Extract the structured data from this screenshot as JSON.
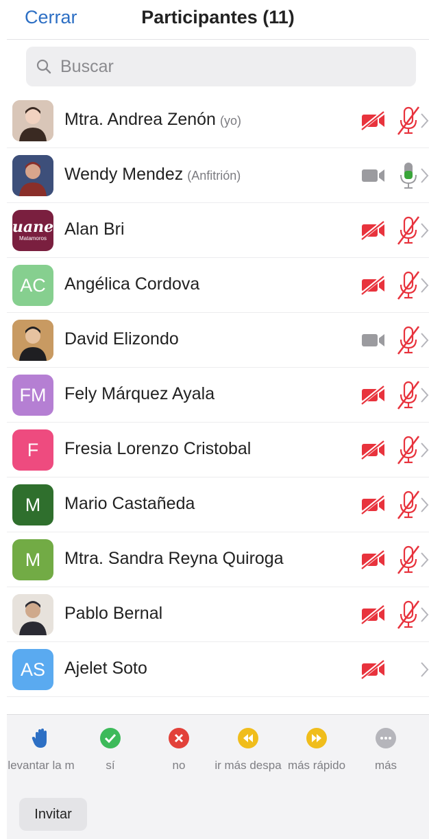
{
  "header": {
    "close_label": "Cerrar",
    "title": "Participantes (11)"
  },
  "search": {
    "placeholder": "Buscar"
  },
  "colors": {
    "accent": "#2d6fc4",
    "muted_red": "#e8333d",
    "mic_green": "#3aa53a",
    "camera_gray": "#9b9b9f"
  },
  "participants": [
    {
      "name": "Mtra. Andrea Zenón",
      "role": "(yo)",
      "avatar_type": "photo",
      "avatar_icon": "avatar-photo",
      "video": "off",
      "mic": "muted"
    },
    {
      "name": "Wendy Mendez",
      "role": "(Anfitrión)",
      "avatar_type": "photo",
      "avatar_icon": "avatar-photo",
      "video": "on",
      "mic": "on"
    },
    {
      "name": "Alan Bri",
      "role": "",
      "avatar_type": "logo",
      "avatar_logo_text": "uane",
      "avatar_logo_sub": "Matamoros",
      "avatar_color": "#7a1f3f",
      "video": "off",
      "mic": "muted"
    },
    {
      "name": "Angélica Cordova",
      "role": "",
      "avatar_type": "initials",
      "initials": "AC",
      "avatar_color": "#86cf8f",
      "video": "off",
      "mic": "muted"
    },
    {
      "name": "David Elizondo",
      "role": "",
      "avatar_type": "photo",
      "avatar_icon": "avatar-photo",
      "video": "on",
      "mic": "muted"
    },
    {
      "name": "Fely Márquez Ayala",
      "role": "",
      "avatar_type": "initials",
      "initials": "FM",
      "avatar_color": "#b57fd3",
      "video": "off",
      "mic": "muted"
    },
    {
      "name": "Fresia Lorenzo Cristobal",
      "role": "",
      "avatar_type": "initials",
      "initials": "F",
      "avatar_color": "#ee4b7f",
      "video": "off",
      "mic": "muted"
    },
    {
      "name": "Mario Castañeda",
      "role": "",
      "avatar_type": "initials",
      "initials": "M",
      "avatar_color": "#2f6f2d",
      "video": "off",
      "mic": "muted"
    },
    {
      "name": "Mtra. Sandra Reyna Quiroga",
      "role": "",
      "avatar_type": "initials",
      "initials": "M",
      "avatar_color": "#72ab45",
      "video": "off",
      "mic": "muted"
    },
    {
      "name": "Pablo Bernal",
      "role": "",
      "avatar_type": "photo",
      "avatar_icon": "avatar-photo",
      "video": "off",
      "mic": "muted"
    },
    {
      "name": "Ajelet Soto",
      "role": "",
      "avatar_type": "initials",
      "initials": "AS",
      "avatar_color": "#5aaaf0",
      "video": "off",
      "mic": "none"
    }
  ],
  "reactions": [
    {
      "label": "levantar la m",
      "icon": "raise-hand-icon",
      "color": "#2d6fc4"
    },
    {
      "label": "sí",
      "icon": "check-icon",
      "color": "#3dba5a"
    },
    {
      "label": "no",
      "icon": "x-icon",
      "color": "#e2413a"
    },
    {
      "label": "ir más despa",
      "icon": "slower-icon",
      "color": "#f0bd1c"
    },
    {
      "label": "más rápido",
      "icon": "faster-icon",
      "color": "#f0bd1c"
    },
    {
      "label": "más",
      "icon": "more-icon",
      "color": "#b5b5bb"
    }
  ],
  "invite_label": "Invitar"
}
